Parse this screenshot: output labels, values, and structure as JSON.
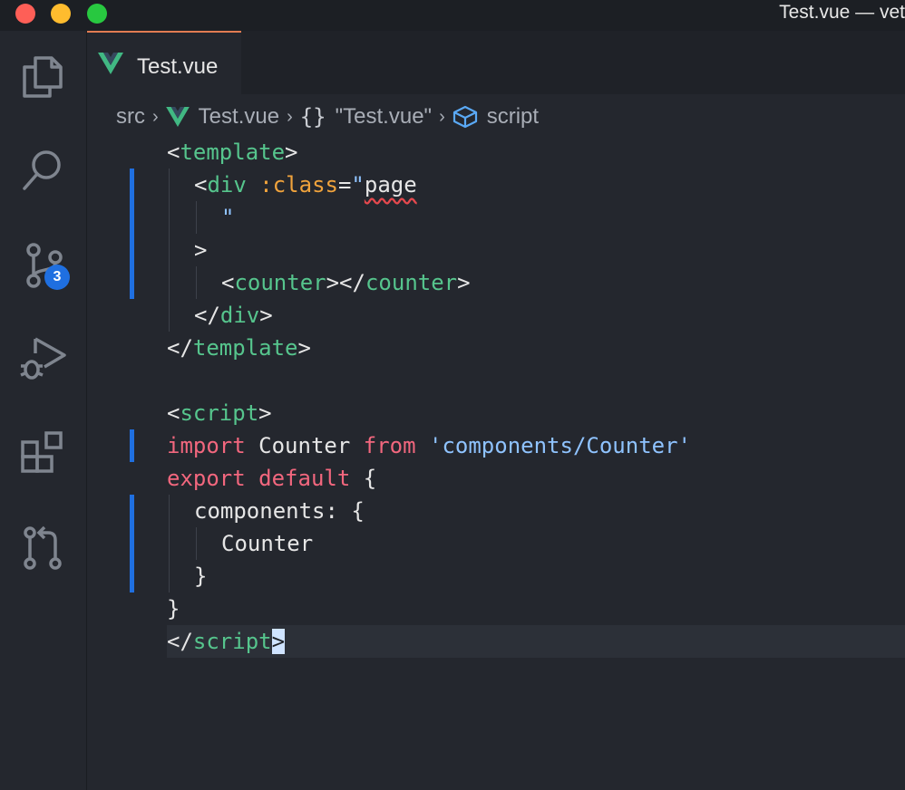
{
  "window": {
    "title": "Test.vue — vet"
  },
  "activity_bar": {
    "items": [
      {
        "icon": "files-icon"
      },
      {
        "icon": "search-icon"
      },
      {
        "icon": "source-control-icon",
        "badge": "3"
      },
      {
        "icon": "run-debug-icon"
      },
      {
        "icon": "extensions-icon"
      },
      {
        "icon": "pull-request-icon"
      }
    ]
  },
  "tab": {
    "label": "Test.vue",
    "icon": "vue-icon",
    "accent": "#e27c52"
  },
  "breadcrumb": {
    "items": [
      "src",
      "Test.vue",
      "\"Test.vue\"",
      "script"
    ],
    "icons": [
      "vue-icon",
      "braces-icon",
      "cube-icon"
    ]
  },
  "code": {
    "l1_open": "<",
    "l1_tag": "template",
    "l1_close": ">",
    "l2_open": "<",
    "l2_tag": "div",
    "l2_space": " ",
    "l2_attr": ":class",
    "l2_eq": "=",
    "l2_q": "\"",
    "l2_val": "page",
    "l3_q": "\"",
    "l4_gt": ">",
    "l5_open": "<",
    "l5_tag": "counter",
    "l5_mid": "></",
    "l5_tag2": "counter",
    "l5_close": ">",
    "l6_open": "</",
    "l6_tag": "div",
    "l6_close": ">",
    "l7_open": "</",
    "l7_tag": "template",
    "l7_close": ">",
    "l9_open": "<",
    "l9_tag": "script",
    "l9_close": ">",
    "l10_kw1": "import",
    "l10_name": " Counter ",
    "l10_kw2": "from",
    "l10_sp": " ",
    "l10_str": "'components/Counter'",
    "l11_kw1": "export",
    "l11_sp": " ",
    "l11_kw2": "default",
    "l11_rest": " {",
    "l12_text": "components: {",
    "l13_text": "Counter",
    "l14_text": "}",
    "l15_text": "}",
    "l16_open": "</",
    "l16_tag": "script",
    "l16_close": ">"
  },
  "colors": {
    "tag": "#56c58d",
    "attribute": "#f0a33c",
    "string": "#8fc3ff",
    "keyword": "#f2677e",
    "modified_gutter": "#1f6fe0",
    "badge": "#1f6fe0",
    "background": "#24272e"
  }
}
